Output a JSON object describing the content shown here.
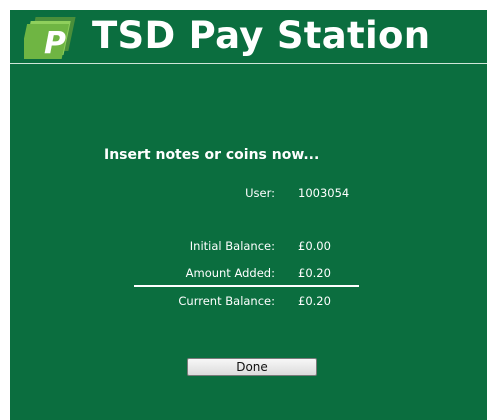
{
  "header": {
    "title": "TSD Pay Station",
    "logo_letter": "P"
  },
  "payment": {
    "prompt": "Insert notes or coins now...",
    "user_label": "User:",
    "user_value": "1003054",
    "initial_balance_label": "Initial Balance:",
    "initial_balance_value": "£0.00",
    "amount_added_label": "Amount Added:",
    "amount_added_value": "£0.20",
    "current_balance_label": "Current Balance:",
    "current_balance_value": "£0.20"
  },
  "actions": {
    "done_label": "Done"
  },
  "colors": {
    "background": "#0b6e3f",
    "text": "#ffffff",
    "logo_green": "#7ec24a"
  }
}
